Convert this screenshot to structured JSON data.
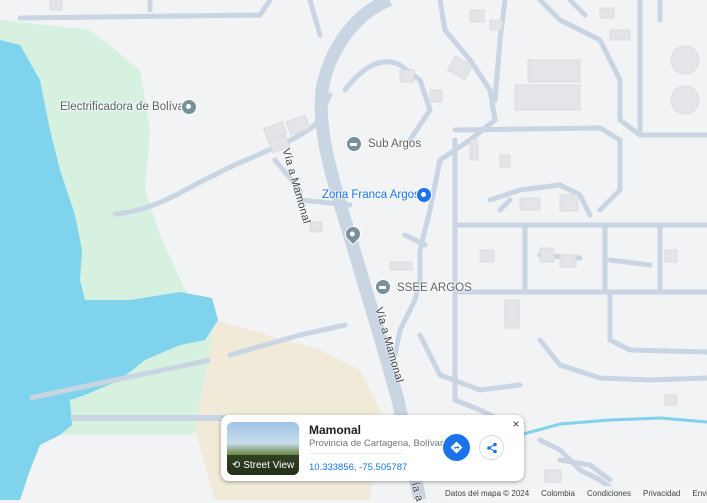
{
  "map": {
    "labels": {
      "electrificadora": "Electrificadora de Bolívar",
      "sub_argos": "Sub Argos",
      "zona_franca": "Zona Franca Argos",
      "ssee_argos": "SSEE ARGOS"
    },
    "roads": {
      "via_upper": "Vía a Mamonal",
      "via_lower": "Vía a Mamonal",
      "via_bottom": "ía a"
    },
    "colors": {
      "water": "#7fd3ec",
      "park": "#d7f1e0",
      "sand": "#f2ead9",
      "road": "#c9d5e3",
      "land": "#f1f3f4",
      "accent": "#1a73e8"
    }
  },
  "card": {
    "title": "Mamonal",
    "subtitle": "Provincia de Cartagena, Bolívar",
    "coords": "10.333856, -75.505787",
    "street_view": "Street View",
    "close": "×"
  },
  "footer": {
    "data": "Datos del mapa © 2024",
    "country": "Colombia",
    "terms": "Condiciones",
    "privacy": "Privacidad",
    "feedback": "Enviar c"
  }
}
